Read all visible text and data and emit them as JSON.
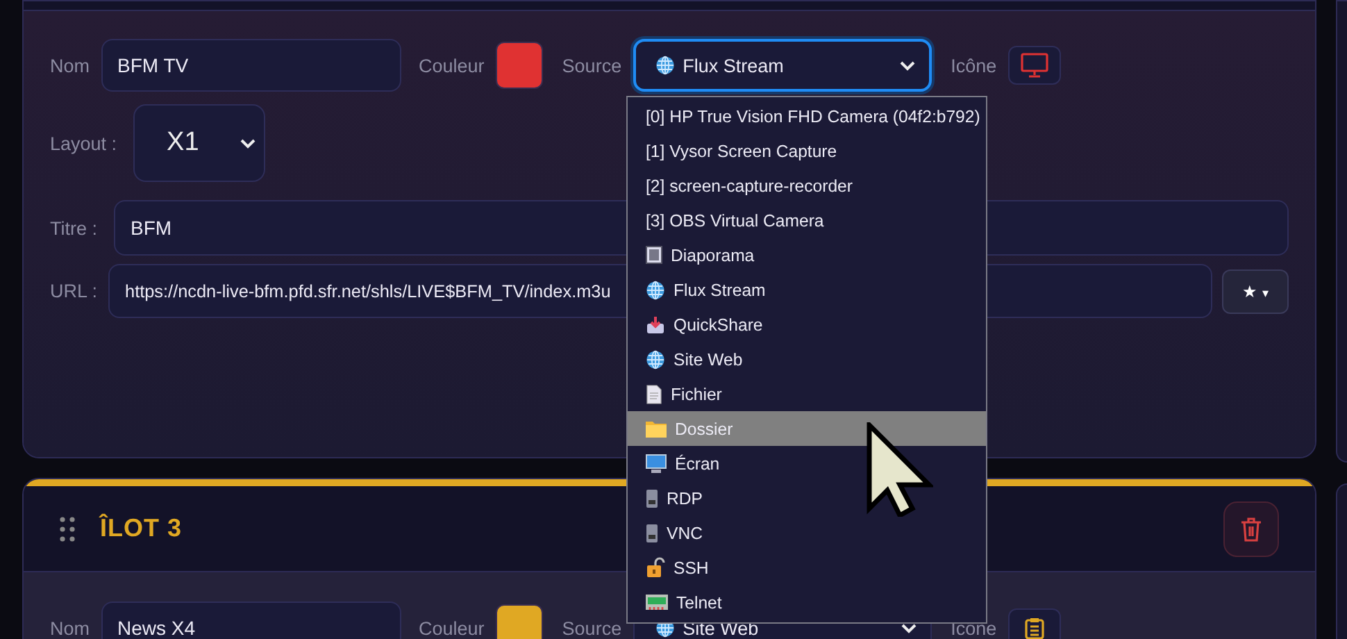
{
  "cards": [
    {
      "color": "#e03232",
      "name_label": "Nom",
      "name": "BFM TV",
      "color_label": "Couleur",
      "source_label": "Source",
      "source": {
        "kind": "globe",
        "value": "Flux Stream",
        "focused": true
      },
      "icon_label": "Icône",
      "icon": {
        "kind": "monitor"
      },
      "layout_label": "Layout :",
      "layout": "X1",
      "title_label": "Titre :",
      "title": "BFM",
      "url_label": "URL :",
      "url": "https://ncdn-live-bfm.pfd.sfr.net/shls/LIVE$BFM_TV/index.m3u",
      "favorite_button": {
        "star": "★",
        "caret": "▾"
      }
    },
    {
      "color": "#e0a823",
      "heading": "ÎLOT 3",
      "name_label": "Nom",
      "name": "News X4",
      "color_label": "Couleur",
      "source_label": "Source",
      "source": {
        "kind": "globe",
        "value": "Site Web",
        "focused": false
      },
      "icon_label": "Icône",
      "icon": {
        "kind": "clipboard"
      }
    }
  ],
  "source_menu": {
    "items": [
      {
        "label": "[0] HP True Vision FHD Camera (04f2:b792)",
        "kind": "plain",
        "highlighted": false
      },
      {
        "label": "[1] Vysor Screen Capture",
        "kind": "plain",
        "highlighted": false
      },
      {
        "label": "[2] screen-capture-recorder",
        "kind": "plain",
        "highlighted": false
      },
      {
        "label": "[3] OBS Virtual Camera",
        "kind": "plain",
        "highlighted": false
      },
      {
        "label": "Diaporama",
        "kind": "slideshow",
        "highlighted": false
      },
      {
        "label": "Flux Stream",
        "kind": "globe",
        "highlighted": false
      },
      {
        "label": "QuickShare",
        "kind": "share",
        "highlighted": false
      },
      {
        "label": "Site Web",
        "kind": "globe",
        "highlighted": false
      },
      {
        "label": "Fichier",
        "kind": "file",
        "highlighted": false
      },
      {
        "label": "Dossier",
        "kind": "folder",
        "highlighted": true
      },
      {
        "label": "Écran",
        "kind": "screen",
        "highlighted": false
      },
      {
        "label": "RDP",
        "kind": "server",
        "highlighted": false
      },
      {
        "label": "VNC",
        "kind": "server",
        "highlighted": false
      },
      {
        "label": "SSH",
        "kind": "lock",
        "highlighted": false
      },
      {
        "label": "Telnet",
        "kind": "terminal",
        "highlighted": false
      }
    ]
  }
}
